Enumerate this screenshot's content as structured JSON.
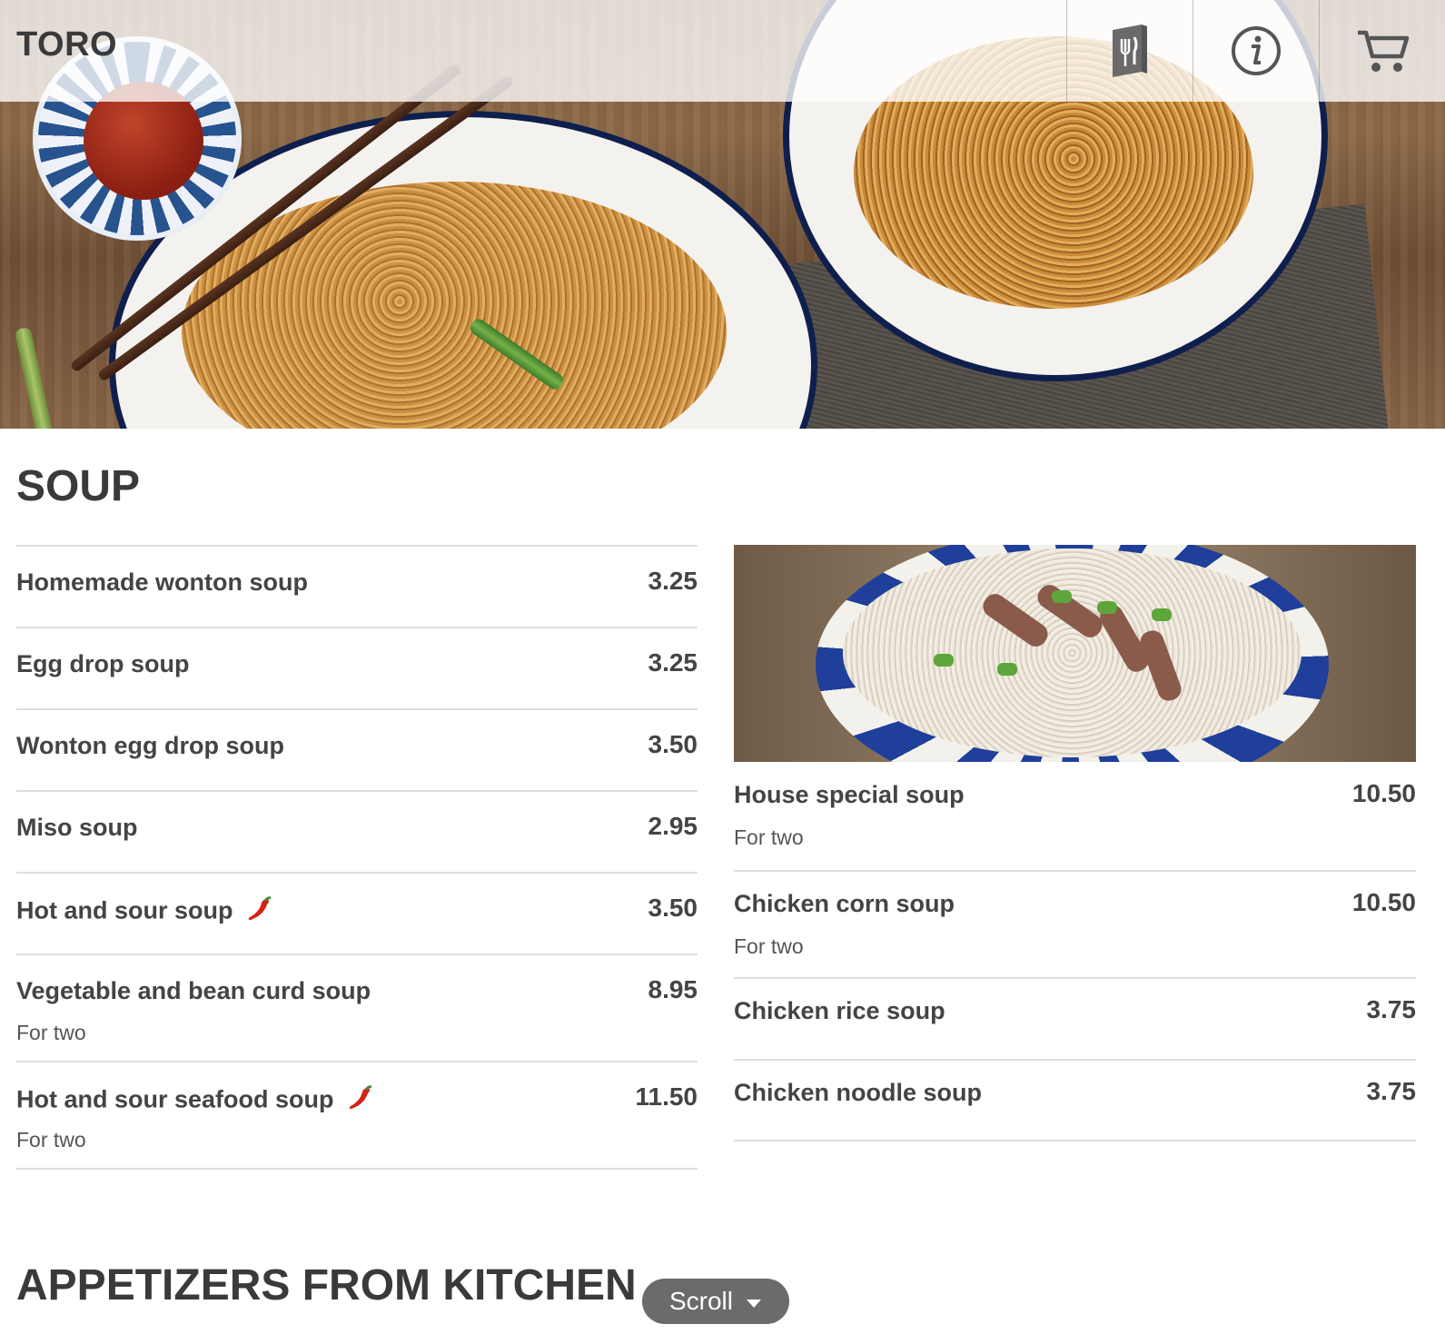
{
  "header": {
    "brand": "TORO",
    "nav": [
      {
        "name": "menu-icon"
      },
      {
        "name": "info-icon"
      },
      {
        "name": "cart-icon"
      }
    ]
  },
  "sections": {
    "soup": {
      "title": "SOUP",
      "left_items": [
        {
          "name": "Homemade wonton soup",
          "price": "3.25"
        },
        {
          "name": "Egg drop soup",
          "price": "3.25"
        },
        {
          "name": "Wonton egg drop soup",
          "price": "3.50"
        },
        {
          "name": "Miso soup",
          "price": "2.95"
        },
        {
          "name": "Hot and sour soup",
          "price": "3.50",
          "spicy": true
        },
        {
          "name": "Vegetable and bean curd soup",
          "price": "8.95",
          "note": "For two"
        },
        {
          "name": "Hot and sour seafood soup",
          "price": "11.50",
          "note": "For two",
          "spicy": true
        }
      ],
      "right_items": [
        {
          "name": "House special soup",
          "price": "10.50",
          "note": "For two"
        },
        {
          "name": "Chicken corn soup",
          "price": "10.50",
          "note": "For two"
        },
        {
          "name": "Chicken rice soup",
          "price": "3.75"
        },
        {
          "name": "Chicken noodle soup",
          "price": "3.75"
        }
      ]
    },
    "appetizers": {
      "title": "APPETIZERS FROM KITCHEN"
    }
  },
  "scroll_button": {
    "label": "Scroll"
  },
  "colors": {
    "text": "#3a3a3a",
    "rule": "#dedede",
    "plate_rim": "#0f1f4d",
    "pill": "#6b6b6b"
  }
}
